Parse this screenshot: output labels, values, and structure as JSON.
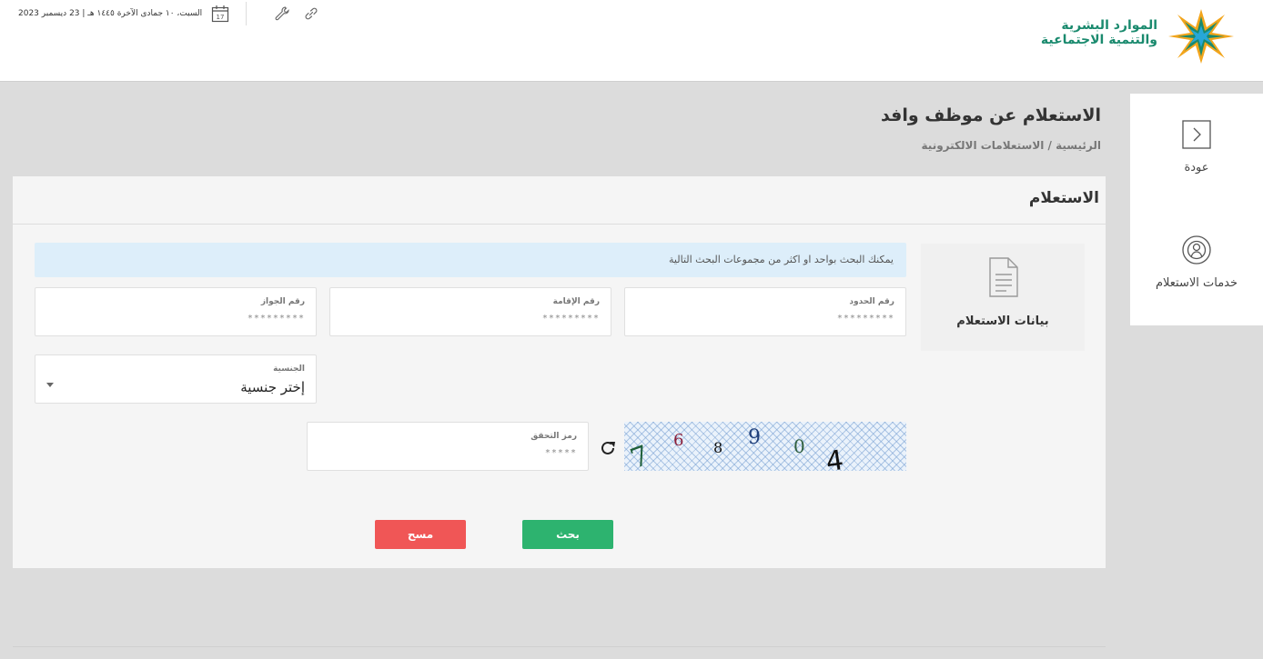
{
  "header": {
    "logo_text_line1": "الموارد البشرية",
    "logo_text_line2": "والتنمية الاجتماعية",
    "date_text": "السبت، ١٠ جمادى الآخرة ١٤٤٥ هـ | 23 ديسمبر 2023",
    "calendar_day": "17"
  },
  "side_nav": {
    "back_label": "عودة",
    "services_label": "خدمات الاستعلام"
  },
  "page": {
    "title": "الاستعلام عن موظف وافد",
    "breadcrumb": "الرئيسية / الاستعلامات الالكترونية"
  },
  "card": {
    "title": "الاستعلام",
    "info_box_label": "بيانات الاستعلام",
    "hint": "يمكنك البحث بواحد او اكثر من مجموعات البحث التالية"
  },
  "fields": {
    "border_number": {
      "label": "رقم الحدود",
      "placeholder": "*********"
    },
    "iqama_number": {
      "label": "رقم الإقامة",
      "placeholder": "*********"
    },
    "passport_number": {
      "label": "رقم الجواز",
      "placeholder": "*********"
    },
    "nationality": {
      "label": "الجنسية",
      "value": "إختر جنسية"
    },
    "captcha_code": {
      "label": "رمز التحقق",
      "placeholder": "*****"
    }
  },
  "captcha": {
    "digits": [
      "7",
      "6",
      "8",
      "9",
      "0",
      "4"
    ],
    "digit_colors": [
      "#1f5f3a",
      "#8a1f3a",
      "#111111",
      "#1f3f7a",
      "#2f5f3f",
      "#111111"
    ]
  },
  "buttons": {
    "search_label": "بحث",
    "clear_label": "مسح"
  },
  "colors": {
    "brand_green": "#1a8a6e",
    "search_button": "#2db36f",
    "clear_button": "#f05656",
    "hint_background": "#ddeefa"
  }
}
